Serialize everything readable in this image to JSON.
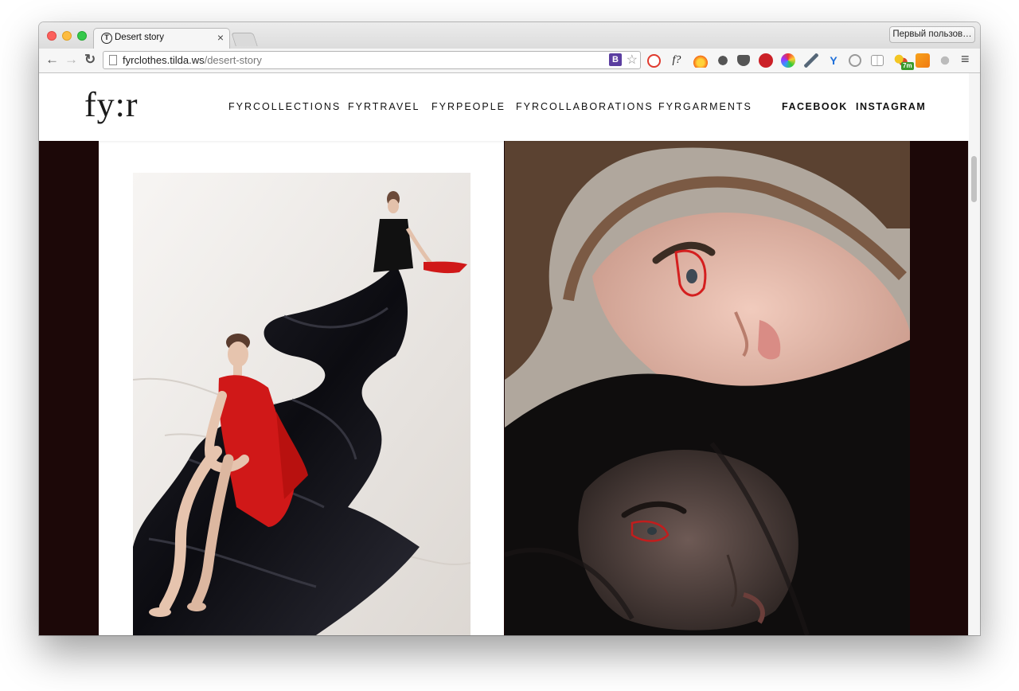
{
  "browser": {
    "tab_title": "Desert story",
    "tab_favicon": "T",
    "tab_close": "×",
    "profile_button": "Первый пользов…",
    "url_host": "fyrclothes.tilda.ws",
    "url_path": "/desert-story",
    "back_icon": "←",
    "forward_icon": "→",
    "reload_icon": "↻",
    "bookmark_ext_label": "B",
    "star_icon": "☆",
    "extensions": [
      "shield-ext-icon",
      "formula-ext-icon",
      "fire-ext-icon",
      "evernote-ext-icon",
      "pocket-ext-icon",
      "pinterest-ext-icon",
      "color-ext-icon",
      "eyedropper-ext-icon",
      "yandex-ext-icon",
      "refresh-ext-icon",
      "reader-ext-icon",
      "weather-ext-icon",
      "analytics-ext-icon",
      "paw-ext-icon"
    ],
    "ext_formula_label": "f?",
    "ext_weather_badge": "7m",
    "menu_icon": "≡"
  },
  "site": {
    "logo": "fy:r",
    "nav": [
      "FYRCOLLECTIONS",
      "FYRTRAVEL",
      "FYRPEOPLE",
      "FYRCOLLABORATIONS",
      "FYRGARMENTS"
    ],
    "social": [
      "FACEBOOK",
      "INSTAGRAM"
    ]
  },
  "colors": {
    "page_bg": "#1c0808",
    "dress_red": "#d01818",
    "fabric_black": "#0e0e12"
  }
}
